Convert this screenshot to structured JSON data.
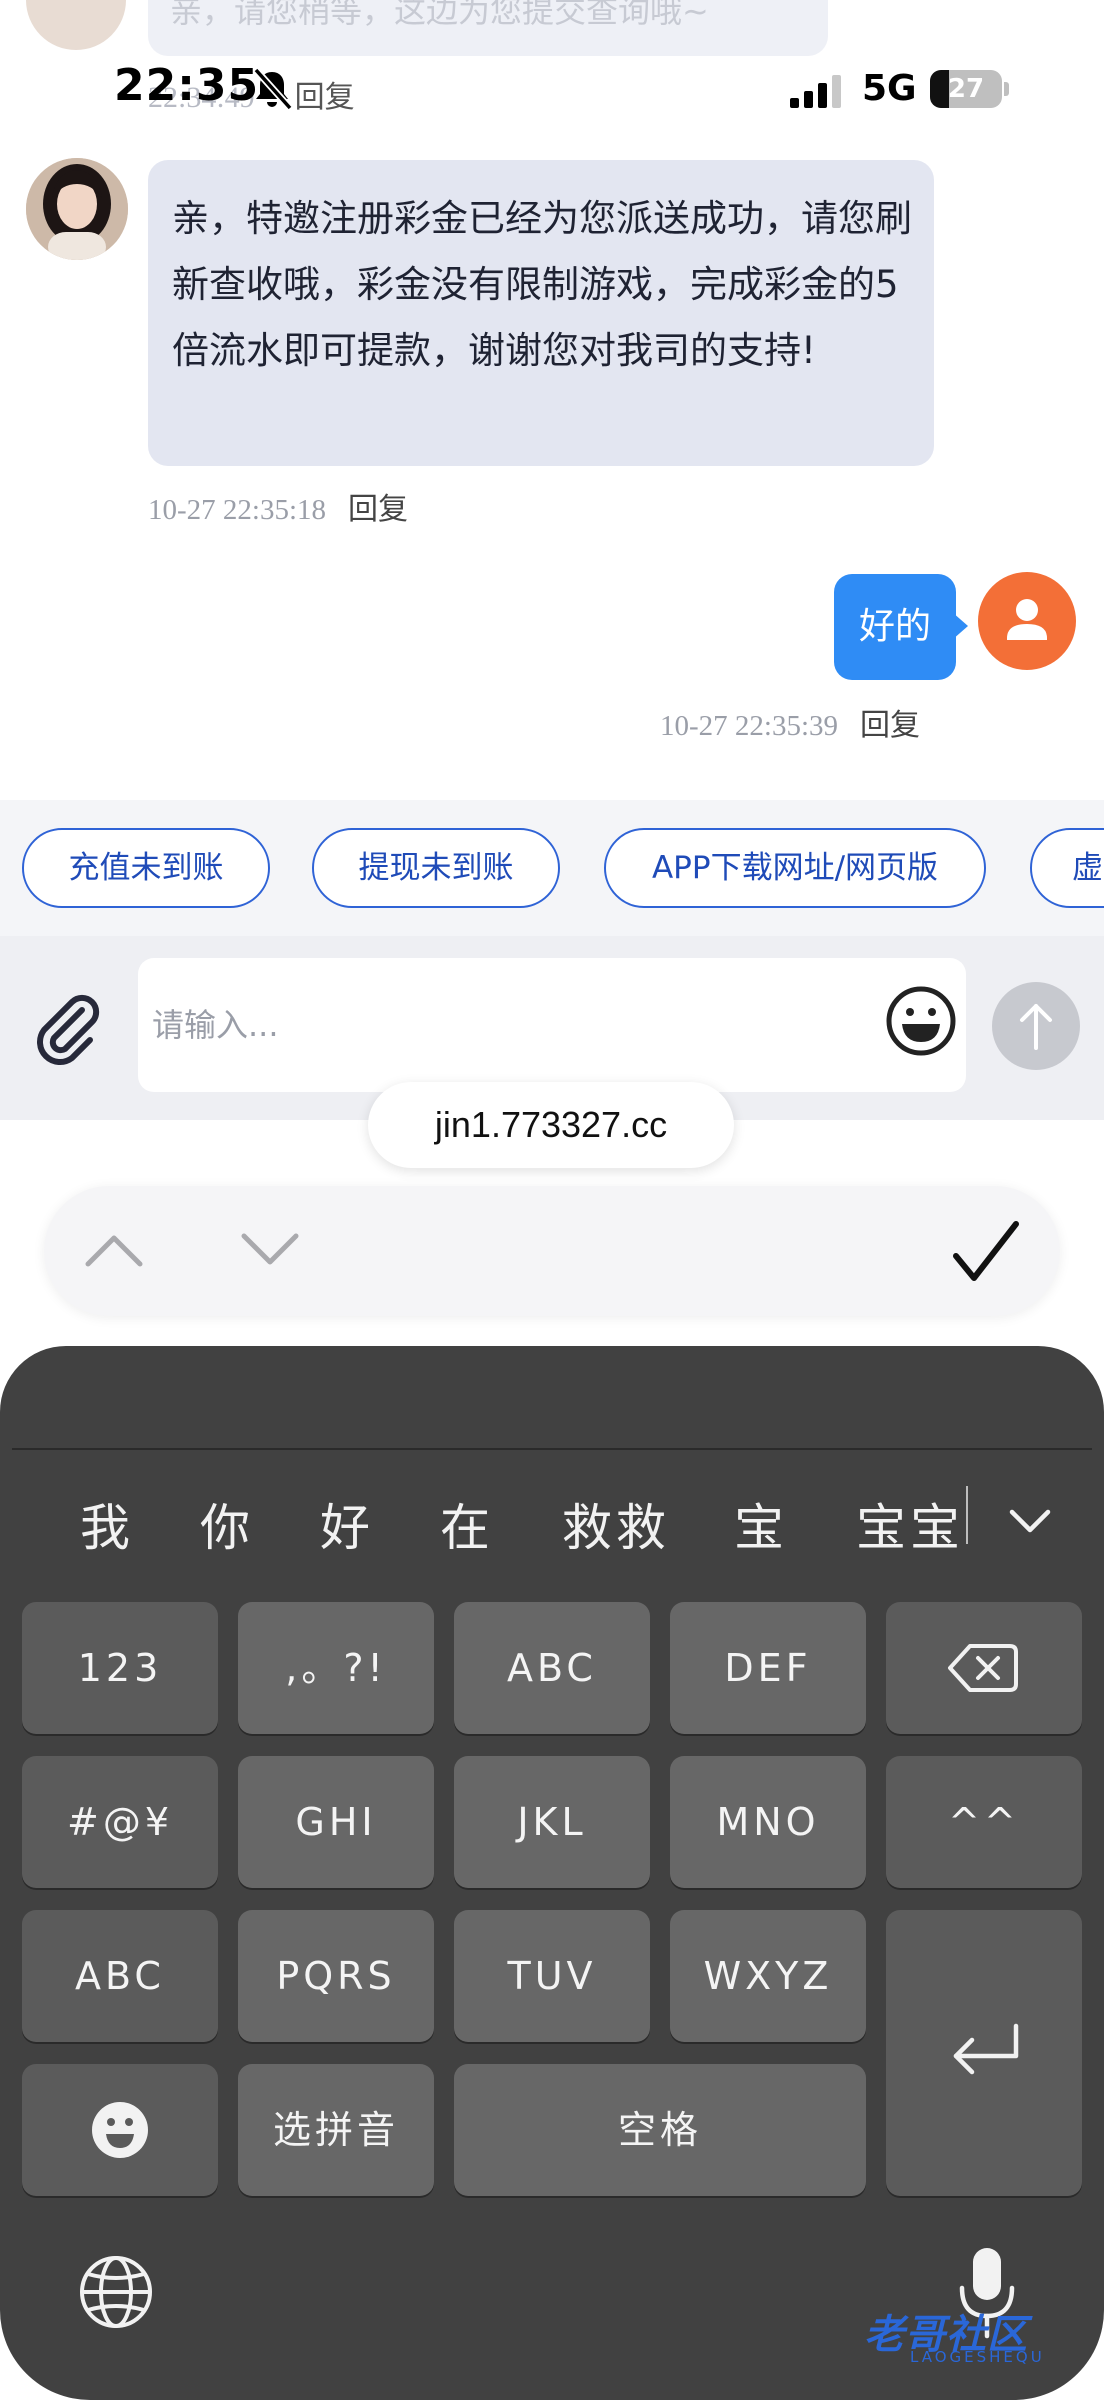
{
  "status_bar": {
    "time": "22:35",
    "network": "5G",
    "battery_level": "27",
    "battery_fraction": 0.27
  },
  "chat": {
    "previous_message": {
      "text": "亲，请您稍等，这边为您提交查询哦~",
      "time": "22:34:49",
      "reply_label": "回复"
    },
    "agent_message": {
      "text": "亲，特邀注册彩金已经为您派送成功，请您刷新查收哦，彩金没有限制游戏，完成彩金的5倍流水即可提款，谢谢您对我司的支持!",
      "timestamp": "10-27 22:35:18",
      "reply_label": "回复"
    },
    "user_message": {
      "text": "好的",
      "timestamp": "10-27 22:35:39",
      "reply_label": "回复"
    }
  },
  "quick_replies": [
    "充值未到账",
    "提现未到账",
    "APP下载网址/网页版",
    "虚"
  ],
  "input": {
    "placeholder": "请输入..."
  },
  "autofill_url": "jin1.773327.cc",
  "keyboard": {
    "candidates": [
      "我",
      "你",
      "好",
      "在",
      "救救",
      "宝",
      "宝宝"
    ],
    "rows": [
      [
        "123",
        ",。?!",
        "ABC",
        "DEF",
        "delete"
      ],
      [
        "#@¥",
        "GHI",
        "JKL",
        "MNO",
        "^^"
      ],
      [
        "ABC",
        "PQRS",
        "TUV",
        "WXYZ",
        "return"
      ],
      [
        "emoji",
        "选拼音",
        "空格"
      ]
    ],
    "space_label": "空格",
    "pinyin_label": "选拼音"
  },
  "watermark": {
    "text": "老哥社区",
    "sub": "LAOGESHEQU"
  },
  "colors": {
    "accent_blue": "#2f8cf5",
    "chip_border": "#2f63d6",
    "agent_bubble": "#e3e6f1",
    "user_avatar": "#f36f37",
    "keyboard_bg": "#414141"
  }
}
